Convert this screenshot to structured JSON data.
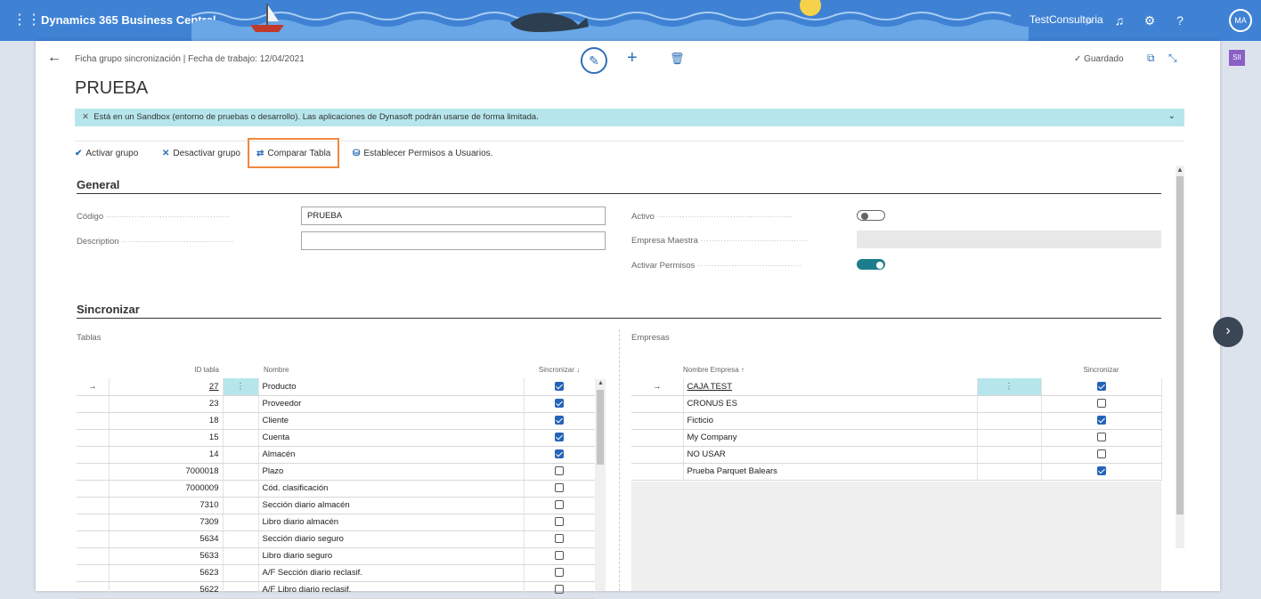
{
  "topbar": {
    "brand": "Dynamics 365 Business Central",
    "tenant": "TestConsultoria",
    "avatar_initials": "MA",
    "icons": [
      "waffle-icon",
      "search-icon",
      "bell-icon",
      "gear-icon",
      "help-icon"
    ]
  },
  "header": {
    "breadcrumb": "Ficha grupo sincronización | Fecha de trabajo: 12/04/2021",
    "title": "PRUEBA",
    "saved_label": "Guardado",
    "side_tag": "SII"
  },
  "banner": {
    "text": "Está en un Sandbox (entorno de pruebas o desarrollo). Las aplicaciones de Dynasoft podrán usarse de forma limitada."
  },
  "actions": [
    {
      "label": "Activar grupo",
      "icon": "✔"
    },
    {
      "label": "Desactivar grupo",
      "icon": "✕"
    },
    {
      "label": "Comparar Tabla",
      "icon": "⇄"
    },
    {
      "label": "Establecer Permisos a Usuarios.",
      "icon": "⛁"
    }
  ],
  "general": {
    "heading": "General",
    "codigo_label": "Código",
    "codigo_value": "PRUEBA",
    "description_label": "Description",
    "description_value": "",
    "activo_label": "Activo",
    "activo_on": false,
    "empresa_maestra_label": "Empresa Maestra",
    "empresa_maestra_value": "",
    "activar_permisos_label": "Activar Permisos",
    "activar_permisos_on": true
  },
  "sincronizar": {
    "heading": "Sincronizar",
    "tablas": {
      "label": "Tablas",
      "columns": [
        "ID tabla",
        "Nombre",
        "Sincronizar ↓"
      ],
      "rows": [
        {
          "arrow": "→",
          "id": "27",
          "nombre": "Producto",
          "sync": true
        },
        {
          "arrow": "",
          "id": "23",
          "nombre": "Proveedor",
          "sync": true
        },
        {
          "arrow": "",
          "id": "18",
          "nombre": "Cliente",
          "sync": true
        },
        {
          "arrow": "",
          "id": "15",
          "nombre": "Cuenta",
          "sync": true
        },
        {
          "arrow": "",
          "id": "14",
          "nombre": "Almacén",
          "sync": true
        },
        {
          "arrow": "",
          "id": "7000018",
          "nombre": "Plazo",
          "sync": false
        },
        {
          "arrow": "",
          "id": "7000009",
          "nombre": "Cód. clasificación",
          "sync": false
        },
        {
          "arrow": "",
          "id": "7310",
          "nombre": "Sección diario almacén",
          "sync": false
        },
        {
          "arrow": "",
          "id": "7309",
          "nombre": "Libro diario almacén",
          "sync": false
        },
        {
          "arrow": "",
          "id": "5634",
          "nombre": "Sección diario seguro",
          "sync": false
        },
        {
          "arrow": "",
          "id": "5633",
          "nombre": "Libro diario seguro",
          "sync": false
        },
        {
          "arrow": "",
          "id": "5623",
          "nombre": "A/F Sección diario reclasif.",
          "sync": false
        },
        {
          "arrow": "",
          "id": "5622",
          "nombre": "A/F Libro diario reclasif.",
          "sync": false
        }
      ]
    },
    "empresas": {
      "label": "Empresas",
      "columns": [
        "Nombre Empresa ↑",
        "Sincronizar"
      ],
      "rows": [
        {
          "arrow": "→",
          "nombre": "CAJA TEST",
          "sync": true
        },
        {
          "arrow": "",
          "nombre": "CRONUS ES",
          "sync": false
        },
        {
          "arrow": "",
          "nombre": "Ficticio",
          "sync": true
        },
        {
          "arrow": "",
          "nombre": "My Company",
          "sync": false
        },
        {
          "arrow": "",
          "nombre": "NO USAR",
          "sync": false
        },
        {
          "arrow": "",
          "nombre": "Prueba Parquet Balears",
          "sync": true
        }
      ]
    }
  }
}
